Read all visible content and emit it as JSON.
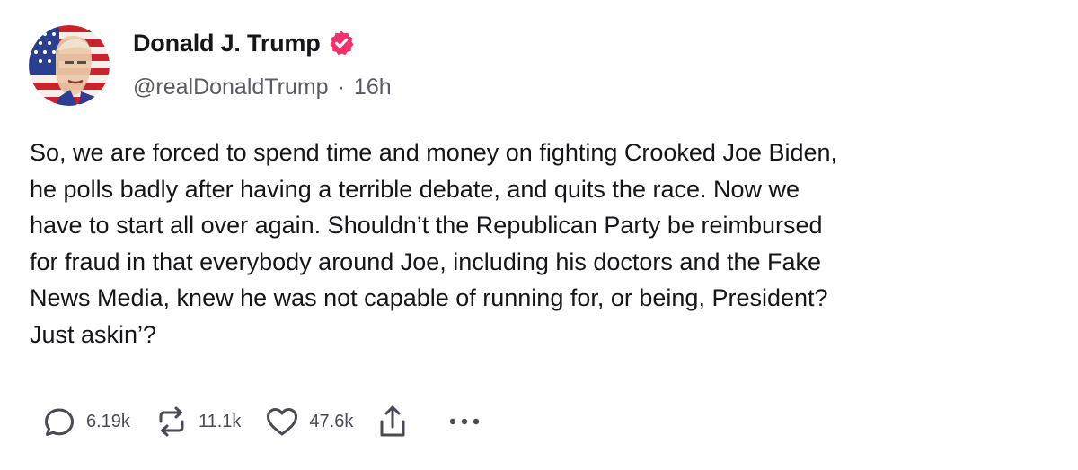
{
  "author": {
    "display_name": "Donald J. Trump",
    "handle": "@realDonaldTrump",
    "separator": "·",
    "timestamp": "16h",
    "verified": true,
    "badge_color": "#f5306c"
  },
  "post": {
    "text": "So, we are forced to spend time and money on fighting Crooked Joe Biden,\nhe polls badly after having a terrible debate, and quits the race. Now we\nhave to start all over again. Shouldn’t the Republican Party be reimbursed\nfor fraud in that everybody around Joe, including his doctors and the Fake\nNews Media, knew he was not capable of running for, or being, President?\nJust askin’?"
  },
  "actions": {
    "reply": {
      "icon": "speech-bubble-icon",
      "count": "6.19k"
    },
    "repost": {
      "icon": "repost-arrows-icon",
      "count": "11.1k"
    },
    "like": {
      "icon": "heart-icon",
      "count": "47.6k"
    },
    "share": {
      "icon": "share-upload-icon"
    },
    "more": {
      "icon": "more-dots-icon"
    }
  },
  "colors": {
    "text": "#16161a",
    "secondary": "#5b5b66",
    "icon": "#4a4a55"
  }
}
